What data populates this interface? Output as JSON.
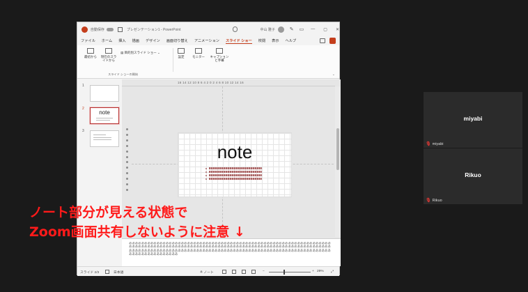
{
  "powerpoint": {
    "titlebar": {
      "autosave_label": "自動保存",
      "filename": "プレゼンテーション1 - PowerPoint",
      "user": "中山 雅子"
    },
    "tabs": [
      "ファイル",
      "ホーム",
      "挿入",
      "描画",
      "デザイン",
      "画面切り替え",
      "アニメーション",
      "スライド ショー",
      "校閲",
      "表示",
      "ヘルプ"
    ],
    "active_tab": "スライド ショー",
    "ribbon": {
      "from_beginning": "最初から",
      "from_current": "現在のスライドから",
      "custom_show": "目的別スライド ショー",
      "setup": "設定",
      "monitor": "モニター",
      "captions": "キャプションと字幕",
      "group_label": "スライド ショーの開始"
    },
    "thumbnails": [
      {
        "number": "1",
        "title": ""
      },
      {
        "number": "2",
        "title": "note"
      },
      {
        "number": "3",
        "title": ""
      }
    ],
    "ruler_top": "16 14 12 10 8 6 4 2 0 2 4 6 8 10 12 14 16",
    "slide": {
      "title": "note"
    },
    "notes_text": "ああああああああああああああああああああああああああああああああああああああああああああああああああああああああああああああああああああああああああああああああああああああああああああああああああああああああああああああああああああああああああああああああああああああああああああああああああああああああああああああああああああああああああああああああああああああああああああああああああああああああああああああああああああああ",
    "statusbar": {
      "slide_info": "スライド 2/3",
      "language": "日本語",
      "notes_label": "ノート",
      "zoom": "29%"
    }
  },
  "participants": [
    {
      "name": "miyabi",
      "label": "miyabi"
    },
    {
      "name": "Rikuo",
      "label": "Rikuo"
    }
  ],
  "annotation": {
    "line1": "ノート部分が見える状態で",
    "line2": "Zoom画面共有しないように注意 ↓"
  }
}
